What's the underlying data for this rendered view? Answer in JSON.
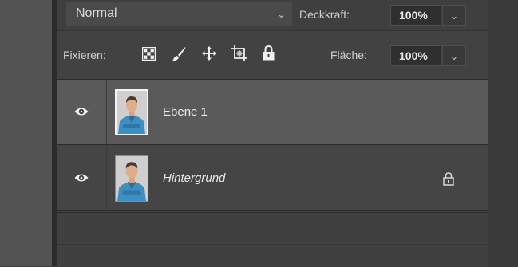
{
  "toolbar": {
    "blend_mode": "Normal",
    "opacity_label": "Deckkraft:",
    "opacity_value": "100%",
    "lock_label": "Fixieren:",
    "fill_label": "Fläche:",
    "fill_value": "100%"
  },
  "lock_icons": [
    "lock-transparent-pixels-icon",
    "lock-image-pixels-icon",
    "lock-position-icon",
    "lock-artboard-icon",
    "lock-all-icon"
  ],
  "layers": [
    {
      "name": "Ebene 1",
      "selected": true,
      "visible": true,
      "locked": false,
      "thumbnail": "portrait-man-blue-shirt"
    },
    {
      "name": "Hintergrund",
      "selected": false,
      "visible": true,
      "locked": true,
      "thumbnail": "portrait-man-blue-shirt"
    }
  ],
  "colors": {
    "panel_bg": "#424242",
    "selected_row": "#5a5a5a",
    "text": "#e8e8e8"
  }
}
